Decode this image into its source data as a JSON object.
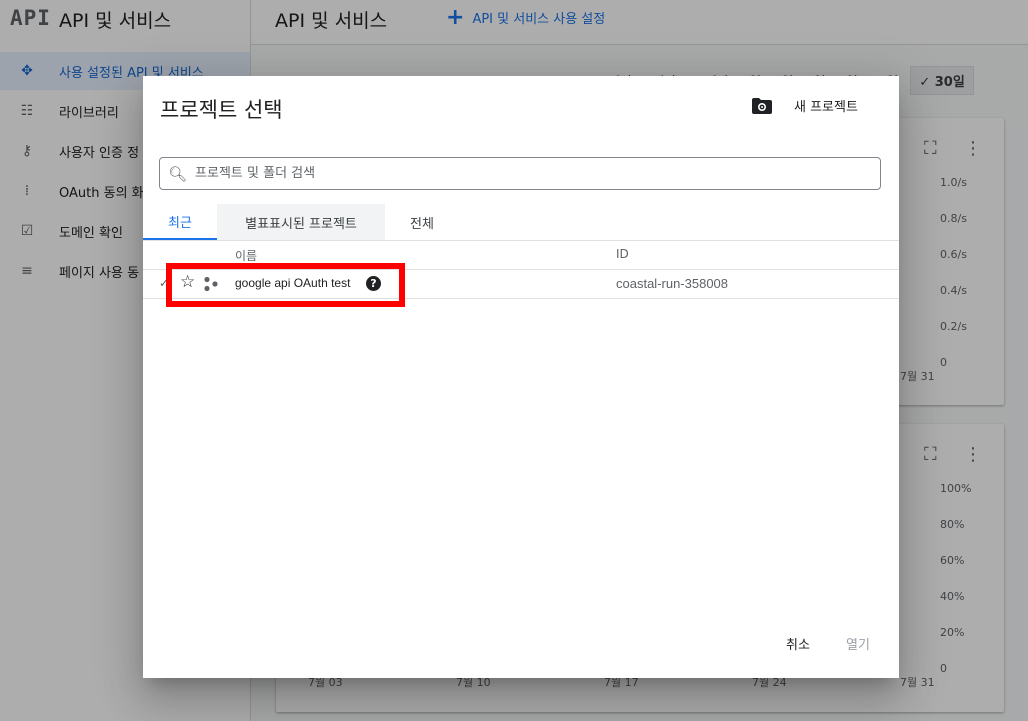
{
  "app": {
    "logo_text": "API",
    "sidebar_title": "API 및 서비스",
    "page_title": "API 및 서비스",
    "enable_button": "API 및 서비스 사용 설정"
  },
  "sidebar": {
    "items": [
      {
        "label": "사용 설정된 API 및 서비스",
        "icon": "api-diamond-icon",
        "active": true
      },
      {
        "label": "라이브러리",
        "icon": "library-icon"
      },
      {
        "label": "사용자 인증 정",
        "icon": "key-icon"
      },
      {
        "label": "OAuth 동의 화",
        "icon": "oauth-dots-icon"
      },
      {
        "label": "도메인 확인",
        "icon": "checkbox-icon"
      },
      {
        "label": "페이지 사용 동",
        "icon": "settings-list-icon"
      }
    ]
  },
  "time_range": {
    "partial_options": [
      "1시간",
      "6시간",
      "12시간",
      "1일",
      "2일",
      "4일",
      "7일"
    ],
    "day14": "14일",
    "day30": "30일"
  },
  "chart1": {
    "yticks": [
      "1.0/s",
      "0.8/s",
      "0.6/s",
      "0.4/s",
      "0.2/s",
      "0"
    ],
    "xlast": "7월 31"
  },
  "chart2": {
    "yticks": [
      "100%",
      "80%",
      "60%",
      "40%",
      "20%",
      "0"
    ],
    "xticks": [
      "7월 03",
      "7월 10",
      "7월 17",
      "7월 24",
      "7월 31"
    ]
  },
  "dialog": {
    "title": "프로젝트 선택",
    "new_project": "새 프로젝트",
    "search_placeholder": "프로젝트 및 폴더 검색",
    "tabs": [
      "최근",
      "별표표시된 프로젝트",
      "전체"
    ],
    "columns": {
      "name": "이름",
      "id": "ID"
    },
    "rows": [
      {
        "name": "google api OAuth test",
        "id": "coastal-run-358008"
      }
    ],
    "cancel": "취소",
    "open": "열기"
  },
  "colors": {
    "accent": "#1a73e8",
    "highlight": "#ff0000"
  }
}
